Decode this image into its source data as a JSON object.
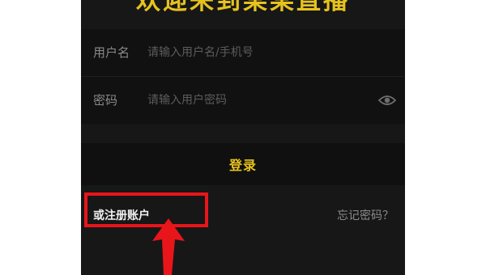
{
  "header": {
    "welcome_text": "欢迎来到某某直播"
  },
  "username_field": {
    "label": "用户名",
    "placeholder": "请输入用户名/手机号",
    "value": ""
  },
  "password_field": {
    "label": "密码",
    "placeholder": "请输入用户密码",
    "value": "",
    "toggle_icon": "eye-icon"
  },
  "login_button": {
    "label": "登录"
  },
  "links": {
    "register": "或注册账户",
    "forgot_password": "忘记密码？"
  },
  "annotation": {
    "highlight_color": "#e8151b",
    "pointer_icon": "arrow-up-icon"
  },
  "colors": {
    "accent": "#e6c21e",
    "background": "#171717",
    "field_background": "#111111"
  }
}
